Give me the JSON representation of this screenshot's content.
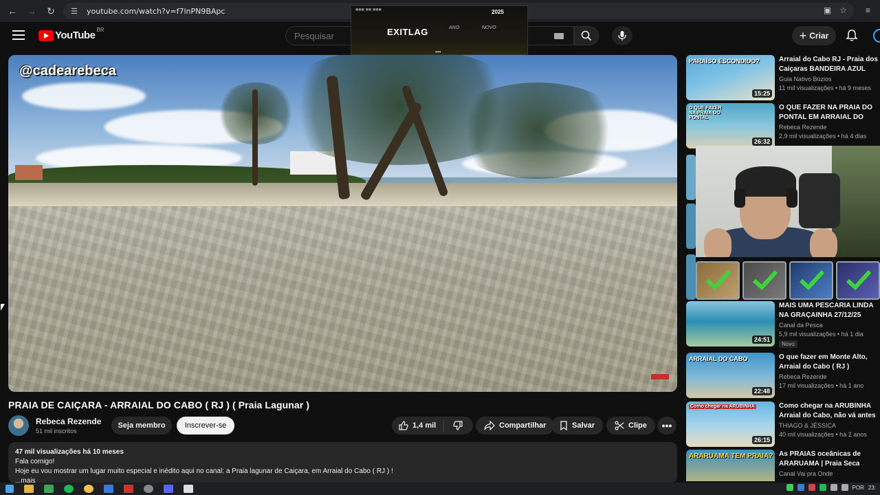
{
  "browser": {
    "url": "youtube.com/watch?v=f7lnPN9BApc",
    "back_icon": "back-arrow-icon",
    "forward_icon": "forward-arrow-icon",
    "reload_icon": "reload-icon"
  },
  "header": {
    "logo_text": "YouTube",
    "region": "BR",
    "search_placeholder": "Pesquisar",
    "create_label": "Criar"
  },
  "overlay": {
    "brand": "EXITLAG",
    "year": "2025",
    "tag_left": "ANO",
    "tag_right": "NOVO",
    "dots": "•••"
  },
  "video": {
    "watermark": "@cadearebeca"
  },
  "main": {
    "title": "PRAIA DE CAIÇARA - ARRAIAL DO CABO ( RJ ) ( Praia Lagunar )",
    "channel_name": "Rebeca Rezende",
    "subscribers": "51 mil inscritos",
    "member_label": "Seja membro",
    "subscribe_label": "Inscrever-se",
    "likes": "1,4 mil",
    "share_label": "Compartilhar",
    "save_label": "Salvar",
    "clip_label": "Clipe",
    "more_label": "•••"
  },
  "description": {
    "meta": "47 mil visualizações  há 10 meses",
    "line1": "Fala comigo!",
    "line2": "Hoje eu vou mostrar um lugar muito especial e inédito aqui no canal: a Praia lagunar de Caiçara, em Arraial do Cabo ( RJ ) !",
    "more": "...mais"
  },
  "sidebar": {
    "items": [
      {
        "title": "Arraial do Cabo RJ - Praia dos Caiçaras BANDEIRA AZUL",
        "channel": "Guia Nativo Búzios",
        "stats": "11 mil visualizações • há 9 meses",
        "duration": "15:25",
        "thumb_label": "PARAÍSO ESCONDIDO?",
        "colors": [
          "#59a9d6",
          "#e9e2c9"
        ]
      },
      {
        "title": "O QUE FAZER NA PRAIA DO PONTAL EM ARRAIAL DO CABO",
        "channel": "Rebeca Rezende",
        "stats": "2,9 mil visualizações • há 4 dias",
        "duration": "26:32",
        "thumb_label": "O QUE FAZER NA PRAIA DO PONTAL",
        "colors": [
          "#4fa7c8",
          "#d9cfb4"
        ]
      },
      {
        "title": "MAIS UMA PESCARIA LINDA NA GRAÇAINHA 27/12/25",
        "channel": "Canal da Pesca",
        "stats": "5,9 mil visualizações • há 1 dia",
        "duration": "24:51",
        "badge": "Novo",
        "thumb_label": "",
        "colors": [
          "#2b8fb3",
          "#a7c9a0"
        ]
      },
      {
        "title": "O que fazer em Monte Alto, Arraial do Cabo ( RJ )",
        "channel": "Rebeca Rezende",
        "stats": "17 mil visualizações • há 1 ano",
        "duration": "22:48",
        "thumb_label": "ARRAIAL DO CABO",
        "colors": [
          "#3f94c7",
          "#d4c8a7"
        ]
      },
      {
        "title": "Como chegar na ARUBINHA Arraial do Cabo, não vá antes ...",
        "channel": "THIAGO & JÉSSICA",
        "stats": "40 mil visualizações • há 2 anos",
        "duration": "26:15",
        "thumb_label": "Como chegar na ARUBINHA",
        "colors": [
          "#62b6e0",
          "#e7dcc0"
        ]
      },
      {
        "title": "As PRAIAS oceânicas de ARARUAMA | Praia Seca",
        "channel": "Canal Vai pra Onde",
        "stats": "",
        "duration": "",
        "thumb_label": "ARARUAMA TEM PRAIA?",
        "colors": [
          "#3d8fbf",
          "#e3c36a"
        ]
      }
    ]
  },
  "taskbar": {
    "lang": "POR",
    "clock": "23:"
  }
}
